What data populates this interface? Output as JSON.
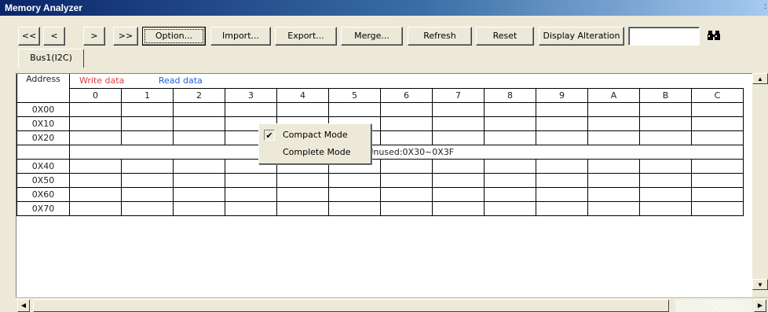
{
  "window": {
    "title": "Memory Analyzer"
  },
  "toolbar": {
    "first": "<<",
    "prev": "<",
    "next": ">",
    "last": ">>",
    "option": "Option...",
    "import": "Import...",
    "export": "Export...",
    "merge": "Merge...",
    "refresh": "Refresh",
    "reset": "Reset",
    "display_alteration": "Display Alteration",
    "find_value": ""
  },
  "tabs": [
    {
      "label": "Bus1(I2C)"
    }
  ],
  "table": {
    "address_header": "Address",
    "legend_write": "Write data",
    "legend_read": "Read data",
    "columns": [
      "0",
      "1",
      "2",
      "3",
      "4",
      "5",
      "6",
      "7",
      "8",
      "9",
      "A",
      "B",
      "C"
    ],
    "rows_top": [
      "0X00",
      "0X10",
      "0X20"
    ],
    "unused_label": "...Unused:0X30~0X3F",
    "rows_bottom": [
      "0X40",
      "0X50",
      "0X60",
      "0X70"
    ]
  },
  "context_menu": {
    "items": [
      {
        "label": "Compact Mode",
        "checked": true
      },
      {
        "label": "Complete Mode",
        "checked": false
      }
    ]
  },
  "colors": {
    "write": "#e04040",
    "read": "#2060e0",
    "title_start": "#0a246a"
  }
}
